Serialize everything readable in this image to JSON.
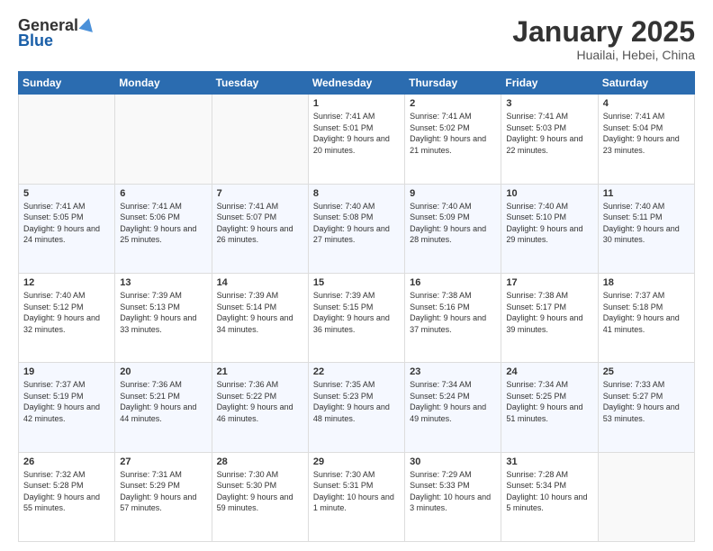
{
  "header": {
    "logo_general": "General",
    "logo_blue": "Blue",
    "month_title": "January 2025",
    "location": "Huailai, Hebei, China"
  },
  "weekdays": [
    "Sunday",
    "Monday",
    "Tuesday",
    "Wednesday",
    "Thursday",
    "Friday",
    "Saturday"
  ],
  "weeks": [
    [
      {
        "day": "",
        "sunrise": "",
        "sunset": "",
        "daylight": ""
      },
      {
        "day": "",
        "sunrise": "",
        "sunset": "",
        "daylight": ""
      },
      {
        "day": "",
        "sunrise": "",
        "sunset": "",
        "daylight": ""
      },
      {
        "day": "1",
        "sunrise": "Sunrise: 7:41 AM",
        "sunset": "Sunset: 5:01 PM",
        "daylight": "Daylight: 9 hours and 20 minutes."
      },
      {
        "day": "2",
        "sunrise": "Sunrise: 7:41 AM",
        "sunset": "Sunset: 5:02 PM",
        "daylight": "Daylight: 9 hours and 21 minutes."
      },
      {
        "day": "3",
        "sunrise": "Sunrise: 7:41 AM",
        "sunset": "Sunset: 5:03 PM",
        "daylight": "Daylight: 9 hours and 22 minutes."
      },
      {
        "day": "4",
        "sunrise": "Sunrise: 7:41 AM",
        "sunset": "Sunset: 5:04 PM",
        "daylight": "Daylight: 9 hours and 23 minutes."
      }
    ],
    [
      {
        "day": "5",
        "sunrise": "Sunrise: 7:41 AM",
        "sunset": "Sunset: 5:05 PM",
        "daylight": "Daylight: 9 hours and 24 minutes."
      },
      {
        "day": "6",
        "sunrise": "Sunrise: 7:41 AM",
        "sunset": "Sunset: 5:06 PM",
        "daylight": "Daylight: 9 hours and 25 minutes."
      },
      {
        "day": "7",
        "sunrise": "Sunrise: 7:41 AM",
        "sunset": "Sunset: 5:07 PM",
        "daylight": "Daylight: 9 hours and 26 minutes."
      },
      {
        "day": "8",
        "sunrise": "Sunrise: 7:40 AM",
        "sunset": "Sunset: 5:08 PM",
        "daylight": "Daylight: 9 hours and 27 minutes."
      },
      {
        "day": "9",
        "sunrise": "Sunrise: 7:40 AM",
        "sunset": "Sunset: 5:09 PM",
        "daylight": "Daylight: 9 hours and 28 minutes."
      },
      {
        "day": "10",
        "sunrise": "Sunrise: 7:40 AM",
        "sunset": "Sunset: 5:10 PM",
        "daylight": "Daylight: 9 hours and 29 minutes."
      },
      {
        "day": "11",
        "sunrise": "Sunrise: 7:40 AM",
        "sunset": "Sunset: 5:11 PM",
        "daylight": "Daylight: 9 hours and 30 minutes."
      }
    ],
    [
      {
        "day": "12",
        "sunrise": "Sunrise: 7:40 AM",
        "sunset": "Sunset: 5:12 PM",
        "daylight": "Daylight: 9 hours and 32 minutes."
      },
      {
        "day": "13",
        "sunrise": "Sunrise: 7:39 AM",
        "sunset": "Sunset: 5:13 PM",
        "daylight": "Daylight: 9 hours and 33 minutes."
      },
      {
        "day": "14",
        "sunrise": "Sunrise: 7:39 AM",
        "sunset": "Sunset: 5:14 PM",
        "daylight": "Daylight: 9 hours and 34 minutes."
      },
      {
        "day": "15",
        "sunrise": "Sunrise: 7:39 AM",
        "sunset": "Sunset: 5:15 PM",
        "daylight": "Daylight: 9 hours and 36 minutes."
      },
      {
        "day": "16",
        "sunrise": "Sunrise: 7:38 AM",
        "sunset": "Sunset: 5:16 PM",
        "daylight": "Daylight: 9 hours and 37 minutes."
      },
      {
        "day": "17",
        "sunrise": "Sunrise: 7:38 AM",
        "sunset": "Sunset: 5:17 PM",
        "daylight": "Daylight: 9 hours and 39 minutes."
      },
      {
        "day": "18",
        "sunrise": "Sunrise: 7:37 AM",
        "sunset": "Sunset: 5:18 PM",
        "daylight": "Daylight: 9 hours and 41 minutes."
      }
    ],
    [
      {
        "day": "19",
        "sunrise": "Sunrise: 7:37 AM",
        "sunset": "Sunset: 5:19 PM",
        "daylight": "Daylight: 9 hours and 42 minutes."
      },
      {
        "day": "20",
        "sunrise": "Sunrise: 7:36 AM",
        "sunset": "Sunset: 5:21 PM",
        "daylight": "Daylight: 9 hours and 44 minutes."
      },
      {
        "day": "21",
        "sunrise": "Sunrise: 7:36 AM",
        "sunset": "Sunset: 5:22 PM",
        "daylight": "Daylight: 9 hours and 46 minutes."
      },
      {
        "day": "22",
        "sunrise": "Sunrise: 7:35 AM",
        "sunset": "Sunset: 5:23 PM",
        "daylight": "Daylight: 9 hours and 48 minutes."
      },
      {
        "day": "23",
        "sunrise": "Sunrise: 7:34 AM",
        "sunset": "Sunset: 5:24 PM",
        "daylight": "Daylight: 9 hours and 49 minutes."
      },
      {
        "day": "24",
        "sunrise": "Sunrise: 7:34 AM",
        "sunset": "Sunset: 5:25 PM",
        "daylight": "Daylight: 9 hours and 51 minutes."
      },
      {
        "day": "25",
        "sunrise": "Sunrise: 7:33 AM",
        "sunset": "Sunset: 5:27 PM",
        "daylight": "Daylight: 9 hours and 53 minutes."
      }
    ],
    [
      {
        "day": "26",
        "sunrise": "Sunrise: 7:32 AM",
        "sunset": "Sunset: 5:28 PM",
        "daylight": "Daylight: 9 hours and 55 minutes."
      },
      {
        "day": "27",
        "sunrise": "Sunrise: 7:31 AM",
        "sunset": "Sunset: 5:29 PM",
        "daylight": "Daylight: 9 hours and 57 minutes."
      },
      {
        "day": "28",
        "sunrise": "Sunrise: 7:30 AM",
        "sunset": "Sunset: 5:30 PM",
        "daylight": "Daylight: 9 hours and 59 minutes."
      },
      {
        "day": "29",
        "sunrise": "Sunrise: 7:30 AM",
        "sunset": "Sunset: 5:31 PM",
        "daylight": "Daylight: 10 hours and 1 minute."
      },
      {
        "day": "30",
        "sunrise": "Sunrise: 7:29 AM",
        "sunset": "Sunset: 5:33 PM",
        "daylight": "Daylight: 10 hours and 3 minutes."
      },
      {
        "day": "31",
        "sunrise": "Sunrise: 7:28 AM",
        "sunset": "Sunset: 5:34 PM",
        "daylight": "Daylight: 10 hours and 5 minutes."
      },
      {
        "day": "",
        "sunrise": "",
        "sunset": "",
        "daylight": ""
      }
    ]
  ]
}
